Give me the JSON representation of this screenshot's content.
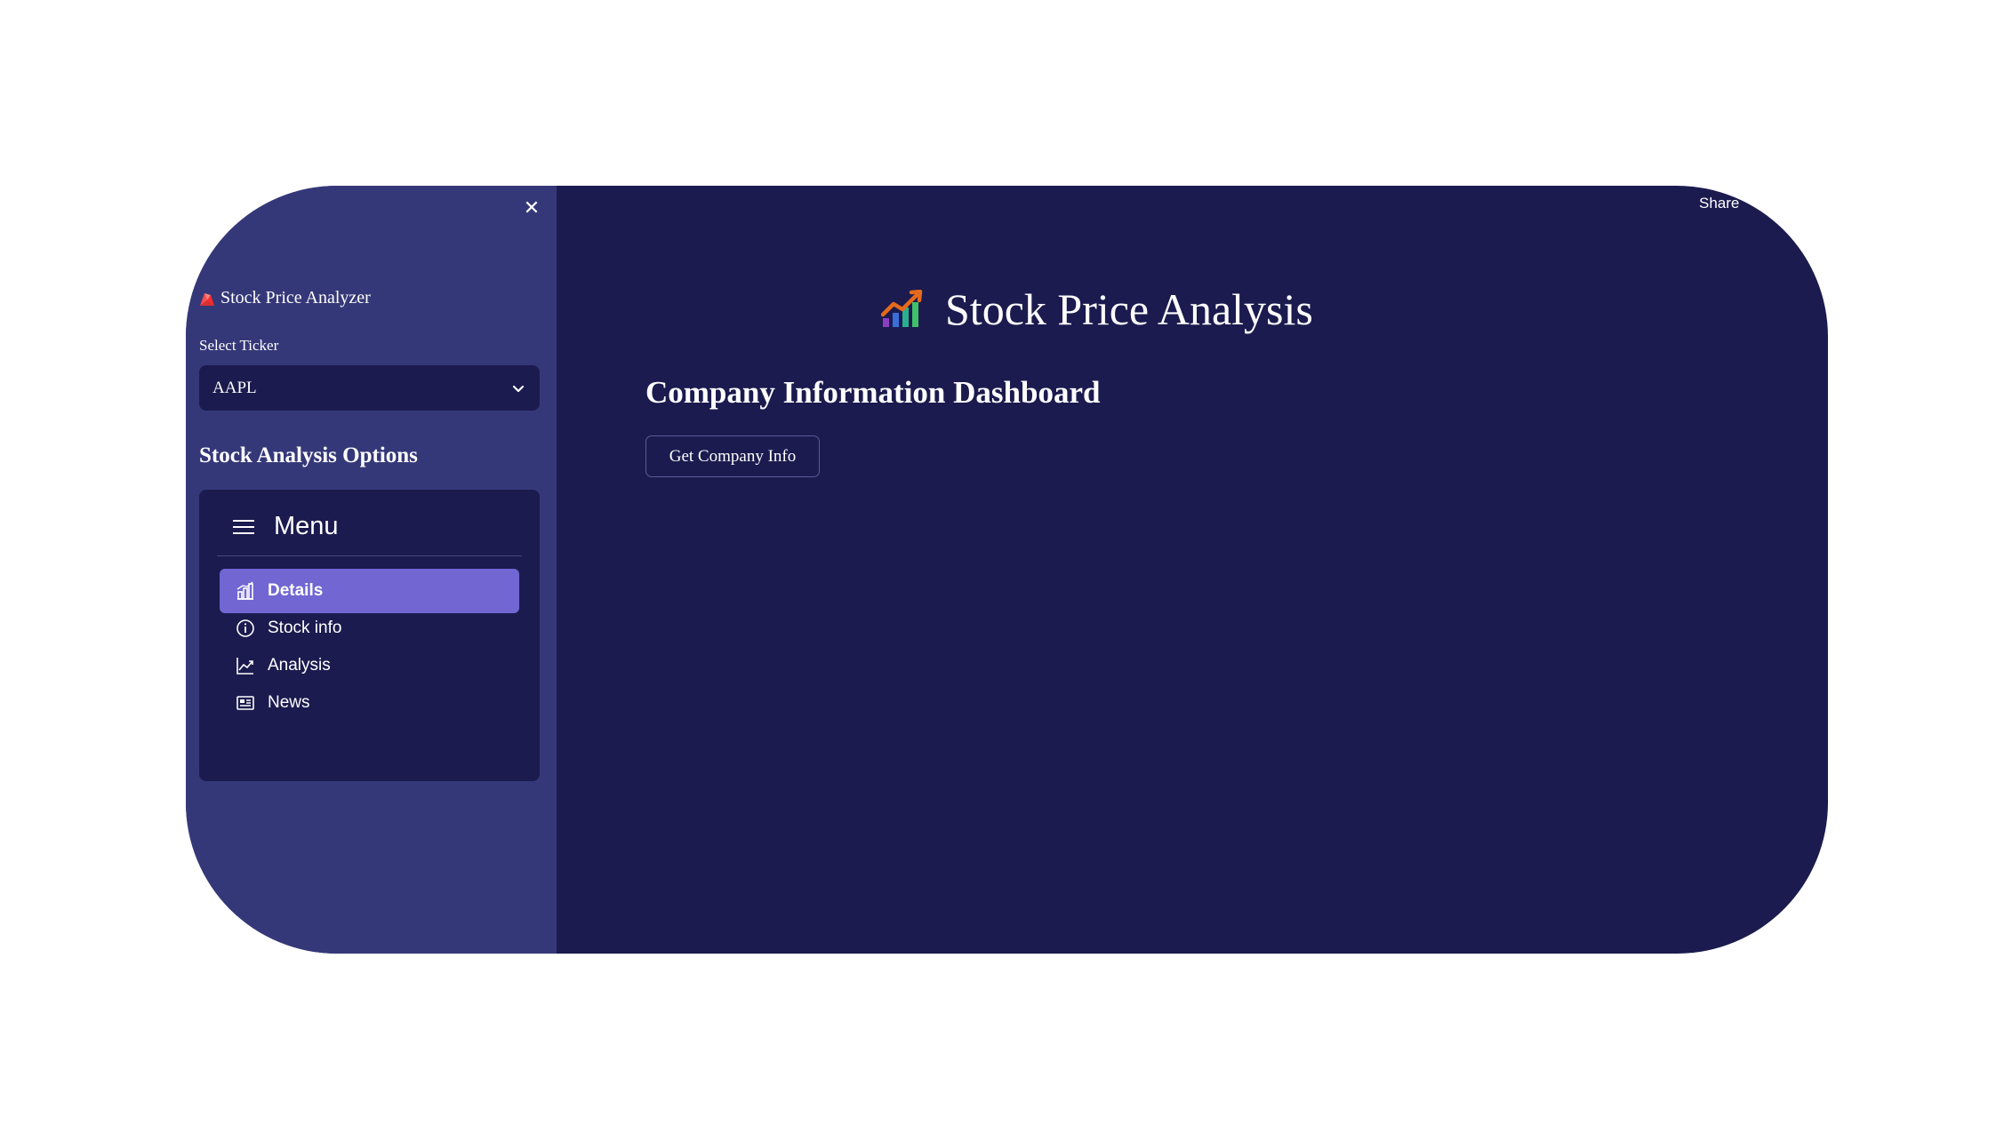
{
  "sidebar": {
    "brand_title": "Stock Price Analyzer",
    "ticker_label": "Select Ticker",
    "ticker_value": "AAPL",
    "options_heading": "Stock Analysis Options",
    "menu": {
      "title": "Menu",
      "items": [
        {
          "label": "Details",
          "icon": "building-chart-icon",
          "active": true
        },
        {
          "label": "Stock info",
          "icon": "info-circle-icon",
          "active": false
        },
        {
          "label": "Analysis",
          "icon": "line-chart-icon",
          "active": false
        },
        {
          "label": "News",
          "icon": "newspaper-icon",
          "active": false
        }
      ]
    }
  },
  "header": {
    "share_label": "Share"
  },
  "main": {
    "page_title": "Stock Price Analysis",
    "section_heading": "Company Information Dashboard",
    "company_button_label": "Get Company Info"
  },
  "colors": {
    "main_bg": "#1b1b4f",
    "sidebar_bg": "#353878",
    "active_item": "#7166d2"
  }
}
